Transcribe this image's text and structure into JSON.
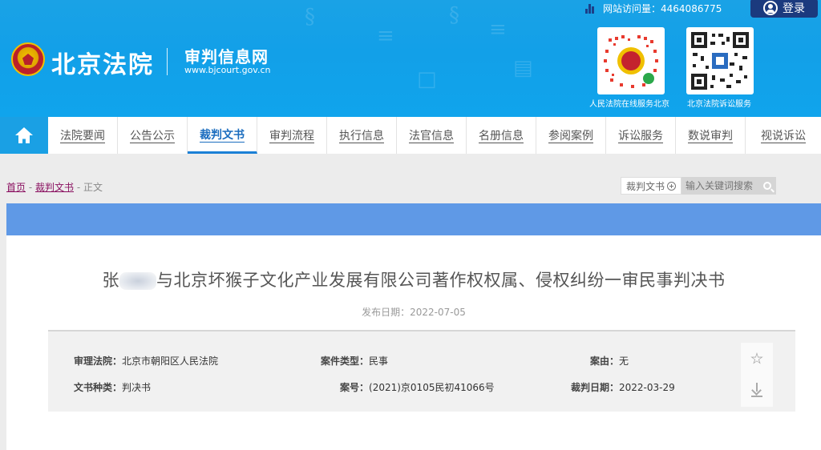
{
  "header": {
    "visits_label": "网站访问量：",
    "visits_count": "4464086775",
    "login_label": "登录",
    "brand": "北京法院",
    "subtitle": "审判信息网",
    "url": "www.bjcourt.gov.cn",
    "qr_captions": [
      "人民法院在线服务北京",
      "北京法院诉讼服务"
    ]
  },
  "nav": {
    "items": [
      "法院要闻",
      "公告公示",
      "裁判文书",
      "审判流程",
      "执行信息",
      "法官信息",
      "名册信息",
      "参阅案例",
      "诉讼服务",
      "数说审判",
      "视说诉讼"
    ],
    "active": "裁判文书"
  },
  "breadcrumb": {
    "home": "首页",
    "sep1": " - ",
    "section": "裁判文书",
    "sep2": " - ",
    "current": "正文"
  },
  "search": {
    "category": "裁判文书",
    "placeholder": "输入关键词搜索"
  },
  "document": {
    "title_prefix": "张",
    "title_rest": "与北京坏猴子文化产业发展有限公司著作权权属、侵权纠纷一审民事判决书",
    "publish_date": "发布日期：2022-07-05",
    "meta": {
      "court_label": "审理法院：",
      "court_value": "北京市朝阳区人民法院",
      "case_type_label": "案件类型：",
      "case_type_value": "民事",
      "cause_label": "案由：",
      "cause_value": "无",
      "doc_type_label": "文书种类：",
      "doc_type_value": "判决书",
      "case_no_label": "案号：",
      "case_no_value": "(2021)京0105民初41066号",
      "judge_date_label": "裁判日期：",
      "judge_date_value": "2022-03-29"
    }
  },
  "colors": {
    "header_blue": "#12a0e8",
    "login_navy": "#1b3a7e",
    "band_blue": "#5f99e6",
    "active_nav": "#1b6dbf"
  },
  "icons": [
    "bar-chart-icon",
    "user-icon",
    "court-emblem-icon",
    "qr-code-icon",
    "home-icon",
    "plus-circle-icon",
    "search-icon",
    "star-icon",
    "download-icon"
  ]
}
